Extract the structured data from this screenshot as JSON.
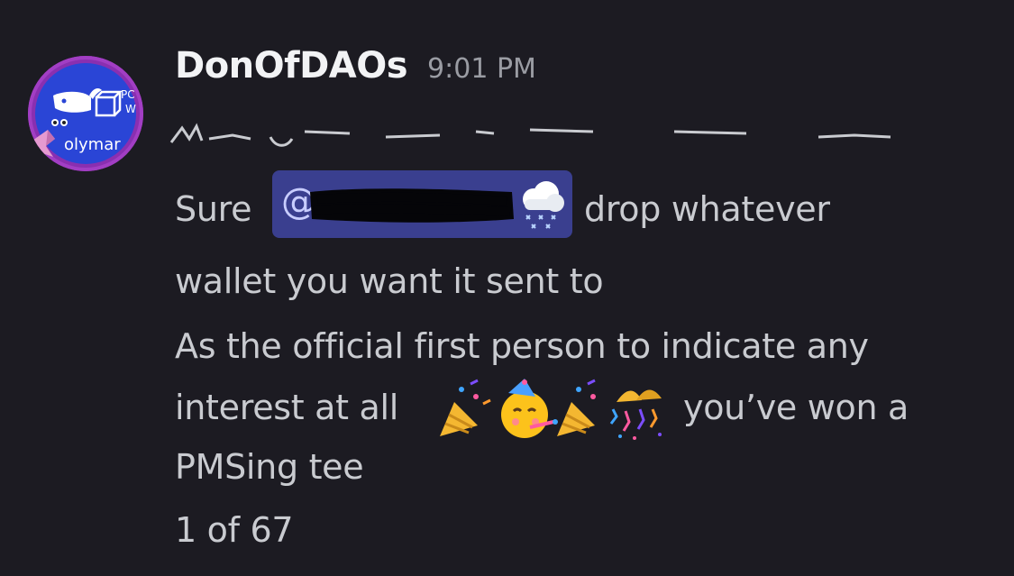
{
  "message": {
    "username": "DonOfDAOs",
    "timestamp": "9:01 PM",
    "avatar": {
      "label_main": "olymar",
      "label_top": "PC",
      "label_mid": "W",
      "background_color": "#2a45d6",
      "border_color": "#a23ec4"
    },
    "line1_prefix": "Sure",
    "mention_symbol": "@",
    "line1_suffix": "drop whatever",
    "line2": "wallet you want it sent to",
    "line3": "As the official first person to indicate any",
    "line4_prefix": "interest at all",
    "line4_suffix": "you’ve won a",
    "line5": "PMSing tee",
    "counter": "1 of 67",
    "emoji_sequence": [
      "party-popper-icon",
      "partying-face-icon",
      "party-popper-icon",
      "confetti-ball-icon"
    ],
    "mention_icon": "cloud-snow-icon"
  },
  "colors": {
    "background": "#1c1b22",
    "text": "#c9cbd0",
    "username": "#f2f3f5",
    "timestamp": "#9a9ca3",
    "mention_bg": "#3a3f8f"
  }
}
